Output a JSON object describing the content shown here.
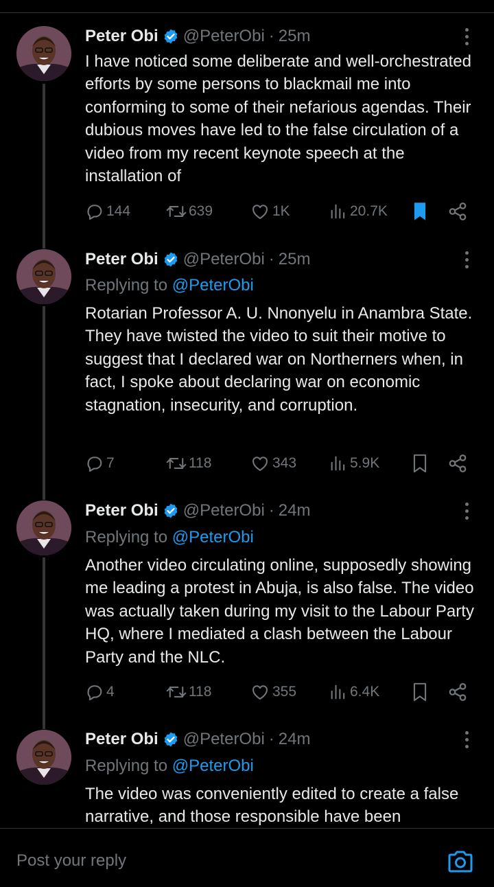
{
  "colors": {
    "background": "#000000",
    "text": "#e7e9ea",
    "secondary": "#71767b",
    "accent": "#1d9bf0",
    "divider": "#2f3336"
  },
  "tweets": [
    {
      "name": "Peter Obi",
      "handle": "@PeterObi",
      "separator": "·",
      "time": "25m",
      "replying_prefix": "",
      "replying_to": "",
      "text": "I have noticed some deliberate and well-orchestrated efforts by some persons to blackmail me into conforming to some of their nefarious agendas. Their dubious moves have led to the false circulation of a video from my recent keynote speech at the installation of",
      "replies": "144",
      "reposts": "639",
      "likes": "1K",
      "views": "20.7K",
      "bookmarked": true
    },
    {
      "name": "Peter Obi",
      "handle": "@PeterObi",
      "separator": "·",
      "time": "25m",
      "replying_prefix": "Replying to ",
      "replying_to": "@PeterObi",
      "text": "Rotarian Professor A. U. Nnonyelu in Anambra State. They have twisted the video to suit their motive to suggest that I declared war on Northerners when, in fact, I spoke about declaring war on economic stagnation, insecurity, and corruption.",
      "replies": "7",
      "reposts": "118",
      "likes": "343",
      "views": "5.9K",
      "bookmarked": false
    },
    {
      "name": "Peter Obi",
      "handle": "@PeterObi",
      "separator": "·",
      "time": "24m",
      "replying_prefix": "Replying to ",
      "replying_to": "@PeterObi",
      "text": "Another video circulating online, supposedly showing me leading a protest in Abuja, is also false. The video was actually taken during my visit to the Labour Party HQ, where I mediated a clash between the Labour Party and the NLC.",
      "replies": "4",
      "reposts": "118",
      "likes": "355",
      "views": "6.4K",
      "bookmarked": false
    },
    {
      "name": "Peter Obi",
      "handle": "@PeterObi",
      "separator": "·",
      "time": "24m",
      "replying_prefix": "Replying to ",
      "replying_to": "@PeterObi",
      "text": "The video was conveniently edited to create a false narrative, and those responsible have been",
      "replies": "",
      "reposts": "",
      "likes": "",
      "views": "",
      "bookmarked": false
    }
  ],
  "reply_bar": {
    "placeholder": "Post your reply",
    "camera_icon": "camera-icon"
  }
}
